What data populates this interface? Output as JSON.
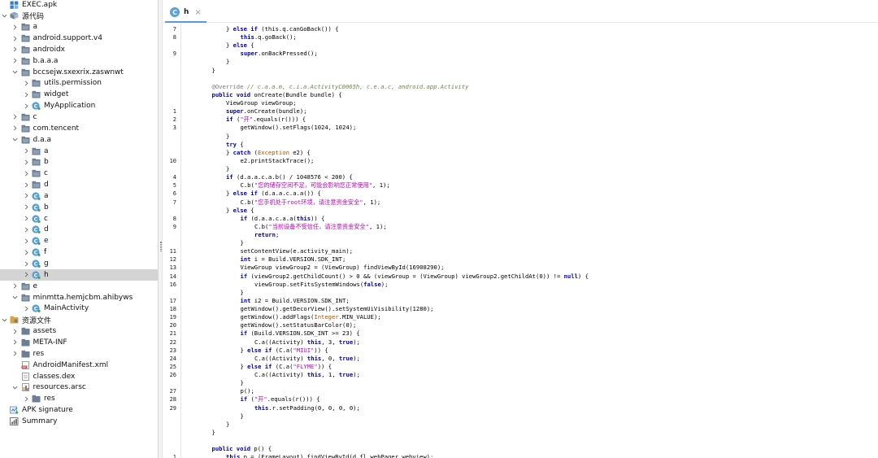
{
  "tree": [
    {
      "label": "EXEC.apk",
      "icon": "apk-icon",
      "chev": "none",
      "indent": 0
    },
    {
      "label": "源代码",
      "icon": "source-icon",
      "chev": "down",
      "indent": 0
    },
    {
      "label": "a",
      "icon": "package-icon",
      "chev": "right",
      "indent": 1
    },
    {
      "label": "android.support.v4",
      "icon": "package-icon",
      "chev": "right",
      "indent": 1
    },
    {
      "label": "androidx",
      "icon": "package-icon",
      "chev": "right",
      "indent": 1
    },
    {
      "label": "b.a.a.a",
      "icon": "package-icon",
      "chev": "right",
      "indent": 1
    },
    {
      "label": "bccsejw.sxexrix.zaswnwt",
      "icon": "package-icon",
      "chev": "down",
      "indent": 1
    },
    {
      "label": "utils.permission",
      "icon": "package-icon",
      "chev": "right",
      "indent": 2
    },
    {
      "label": "widget",
      "icon": "package-icon",
      "chev": "right",
      "indent": 2
    },
    {
      "label": "MyApplication",
      "icon": "class-icon",
      "chev": "right",
      "indent": 2
    },
    {
      "label": "c",
      "icon": "package-icon",
      "chev": "right",
      "indent": 1
    },
    {
      "label": "com.tencent",
      "icon": "package-icon",
      "chev": "right",
      "indent": 1
    },
    {
      "label": "d.a.a",
      "icon": "package-icon",
      "chev": "down",
      "indent": 1
    },
    {
      "label": "a",
      "icon": "package-icon",
      "chev": "right",
      "indent": 2
    },
    {
      "label": "b",
      "icon": "package-icon",
      "chev": "right",
      "indent": 2
    },
    {
      "label": "c",
      "icon": "package-icon",
      "chev": "right",
      "indent": 2
    },
    {
      "label": "d",
      "icon": "package-icon",
      "chev": "right",
      "indent": 2
    },
    {
      "label": "a",
      "icon": "class-icon",
      "chev": "right",
      "indent": 2
    },
    {
      "label": "b",
      "icon": "class-icon",
      "chev": "right",
      "indent": 2
    },
    {
      "label": "c",
      "icon": "class-icon",
      "chev": "right",
      "indent": 2
    },
    {
      "label": "d",
      "icon": "class-icon",
      "chev": "right",
      "indent": 2
    },
    {
      "label": "e",
      "icon": "class-icon",
      "chev": "right",
      "indent": 2
    },
    {
      "label": "f",
      "icon": "class-icon",
      "chev": "right",
      "indent": 2
    },
    {
      "label": "g",
      "icon": "class-icon",
      "chev": "right",
      "indent": 2
    },
    {
      "label": "h",
      "icon": "class-icon",
      "chev": "right",
      "indent": 2,
      "selected": true
    },
    {
      "label": "e",
      "icon": "package-icon",
      "chev": "right",
      "indent": 1
    },
    {
      "label": "minmtta.hemjcbm.ahibyws",
      "icon": "package-icon",
      "chev": "down",
      "indent": 1
    },
    {
      "label": "MainActivity",
      "icon": "class-icon",
      "chev": "right",
      "indent": 2
    },
    {
      "label": "资源文件",
      "icon": "resources-icon",
      "chev": "down",
      "indent": 0
    },
    {
      "label": "assets",
      "icon": "folder-icon",
      "chev": "right",
      "indent": 1
    },
    {
      "label": "META-INF",
      "icon": "folder-icon",
      "chev": "right",
      "indent": 1
    },
    {
      "label": "res",
      "icon": "folder-icon",
      "chev": "right",
      "indent": 1
    },
    {
      "label": "AndroidManifest.xml",
      "icon": "xml-file-icon",
      "chev": "none",
      "indent": 1
    },
    {
      "label": "classes.dex",
      "icon": "file-icon",
      "chev": "none",
      "indent": 1
    },
    {
      "label": "resources.arsc",
      "icon": "arsc-file-icon",
      "chev": "down",
      "indent": 1
    },
    {
      "label": "res",
      "icon": "folder-icon",
      "chev": "right",
      "indent": 2
    },
    {
      "label": "APK signature",
      "icon": "signature-icon",
      "chev": "none",
      "indent": 0
    },
    {
      "label": "Summary",
      "icon": "summary-icon",
      "chev": "none",
      "indent": 0
    }
  ],
  "editor": {
    "tab": {
      "icon_letter": "C",
      "name": "h",
      "close": "×"
    },
    "lines": [
      {
        "n": "7",
        "i": 2,
        "t": [
          [
            "n",
            "} "
          ],
          [
            "k",
            "else if"
          ],
          [
            "n",
            " (this.q.canGoBack()) {"
          ]
        ]
      },
      {
        "n": "8",
        "i": 3,
        "t": [
          [
            "k",
            "this"
          ],
          [
            "n",
            ".q.goBack();"
          ]
        ]
      },
      {
        "n": "",
        "i": 2,
        "t": [
          [
            "n",
            "} "
          ],
          [
            "k",
            "else"
          ],
          [
            "n",
            " {"
          ]
        ]
      },
      {
        "n": "9",
        "i": 3,
        "t": [
          [
            "k",
            "super"
          ],
          [
            "n",
            ".onBackPressed();"
          ]
        ]
      },
      {
        "n": "",
        "i": 2,
        "t": [
          [
            "n",
            "}"
          ]
        ]
      },
      {
        "n": "",
        "i": 1,
        "t": [
          [
            "n",
            "}"
          ]
        ]
      },
      {
        "n": "",
        "i": 0,
        "t": []
      },
      {
        "n": "",
        "i": 1,
        "t": [
          [
            "a",
            "@Override"
          ],
          [
            "c",
            " // c.a.a.m, c.i.a.ActivityC0065h, c.e.a.c, android.app.Activity"
          ]
        ]
      },
      {
        "n": "",
        "i": 1,
        "t": [
          [
            "k",
            "public void"
          ],
          [
            "n",
            " onCreate(Bundle bundle) {"
          ]
        ]
      },
      {
        "n": "",
        "i": 2,
        "t": [
          [
            "n",
            "ViewGroup viewGroup;"
          ]
        ]
      },
      {
        "n": "1",
        "i": 2,
        "t": [
          [
            "k",
            "super"
          ],
          [
            "n",
            ".onCreate(bundle);"
          ]
        ]
      },
      {
        "n": "2",
        "i": 2,
        "t": [
          [
            "k",
            "if"
          ],
          [
            "n",
            " ("
          ],
          [
            "s",
            "\"开\""
          ],
          [
            "n",
            ".equals(r())) {"
          ]
        ]
      },
      {
        "n": "3",
        "i": 3,
        "t": [
          [
            "n",
            "getWindow().setFlags(1024, 1024);"
          ]
        ]
      },
      {
        "n": "",
        "i": 2,
        "t": [
          [
            "n",
            "}"
          ]
        ]
      },
      {
        "n": "",
        "i": 2,
        "t": [
          [
            "k",
            "try"
          ],
          [
            "n",
            " {"
          ]
        ]
      },
      {
        "n": "",
        "i": 2,
        "t": [
          [
            "n",
            "} "
          ],
          [
            "k",
            "catch"
          ],
          [
            "n",
            " ("
          ],
          [
            "ex",
            "Exception"
          ],
          [
            "n",
            " e2) {"
          ]
        ]
      },
      {
        "n": "10",
        "i": 3,
        "t": [
          [
            "n",
            "e2.printStackTrace();"
          ]
        ]
      },
      {
        "n": "",
        "i": 2,
        "t": [
          [
            "n",
            "}"
          ]
        ]
      },
      {
        "n": "4",
        "i": 2,
        "t": [
          [
            "k",
            "if"
          ],
          [
            "n",
            " (d.a.a.c.a.b() / 1048576 < 200) {"
          ]
        ]
      },
      {
        "n": "5",
        "i": 3,
        "t": [
          [
            "n",
            "C.b("
          ],
          [
            "s",
            "\"您的储存空间不足，可能会影响您正常使用\""
          ],
          [
            "n",
            ", 1);"
          ]
        ]
      },
      {
        "n": "6",
        "i": 2,
        "t": [
          [
            "n",
            "} "
          ],
          [
            "k",
            "else if"
          ],
          [
            "n",
            " (d.a.a.c.a.a()) {"
          ]
        ]
      },
      {
        "n": "7",
        "i": 3,
        "t": [
          [
            "n",
            "C.b("
          ],
          [
            "s",
            "\"您手机处于root环境，请注意资金安全\""
          ],
          [
            "n",
            ", 1);"
          ]
        ]
      },
      {
        "n": "",
        "i": 2,
        "t": [
          [
            "n",
            "} "
          ],
          [
            "k",
            "else"
          ],
          [
            "n",
            " {"
          ]
        ]
      },
      {
        "n": "8",
        "i": 3,
        "t": [
          [
            "k",
            "if"
          ],
          [
            "n",
            " (d.a.a.c.a.a("
          ],
          [
            "k",
            "this"
          ],
          [
            "n",
            ")) {"
          ]
        ]
      },
      {
        "n": "9",
        "i": 4,
        "t": [
          [
            "n",
            "C.b("
          ],
          [
            "s",
            "\"当前设备不受信任，请注意资金安全\""
          ],
          [
            "n",
            ", 1);"
          ]
        ]
      },
      {
        "n": "",
        "i": 4,
        "t": [
          [
            "k",
            "return"
          ],
          [
            "n",
            ";"
          ]
        ]
      },
      {
        "n": "",
        "i": 3,
        "t": [
          [
            "n",
            "}"
          ]
        ]
      },
      {
        "n": "11",
        "i": 3,
        "t": [
          [
            "n",
            "setContentView(e.activity_main);"
          ]
        ]
      },
      {
        "n": "12",
        "i": 3,
        "t": [
          [
            "k",
            "int"
          ],
          [
            "n",
            " i = Build.VERSION.SDK_INT;"
          ]
        ]
      },
      {
        "n": "13",
        "i": 3,
        "t": [
          [
            "n",
            "ViewGroup viewGroup2 = (ViewGroup) findViewById(16908290);"
          ]
        ]
      },
      {
        "n": "14",
        "i": 3,
        "t": [
          [
            "k",
            "if"
          ],
          [
            "n",
            " (viewGroup2.getChildCount() > 0 && (viewGroup = (ViewGroup) viewGroup2.getChildAt(0)) != "
          ],
          [
            "k",
            "null"
          ],
          [
            "n",
            ") {"
          ]
        ]
      },
      {
        "n": "16",
        "i": 4,
        "t": [
          [
            "n",
            "viewGroup.setFitsSystemWindows("
          ],
          [
            "k",
            "false"
          ],
          [
            "n",
            ");"
          ]
        ]
      },
      {
        "n": "",
        "i": 3,
        "t": [
          [
            "n",
            "}"
          ]
        ]
      },
      {
        "n": "17",
        "i": 3,
        "t": [
          [
            "k",
            "int"
          ],
          [
            "n",
            " i2 = Build.VERSION.SDK_INT;"
          ]
        ]
      },
      {
        "n": "18",
        "i": 3,
        "t": [
          [
            "n",
            "getWindow().getDecorView().setSystemUiVisibility(1280);"
          ]
        ]
      },
      {
        "n": "19",
        "i": 3,
        "t": [
          [
            "n",
            "getWindow().addFlags("
          ],
          [
            "ex",
            "Integer"
          ],
          [
            "n",
            ".MIN_VALUE);"
          ]
        ]
      },
      {
        "n": "20",
        "i": 3,
        "t": [
          [
            "n",
            "getWindow().setStatusBarColor(0);"
          ]
        ]
      },
      {
        "n": "21",
        "i": 3,
        "t": [
          [
            "k",
            "if"
          ],
          [
            "n",
            " (Build.VERSION.SDK_INT >= 23) {"
          ]
        ]
      },
      {
        "n": "22",
        "i": 4,
        "t": [
          [
            "n",
            "C.a((Activity) "
          ],
          [
            "k",
            "this"
          ],
          [
            "n",
            ", 3, "
          ],
          [
            "k",
            "true"
          ],
          [
            "n",
            ");"
          ]
        ]
      },
      {
        "n": "23",
        "i": 3,
        "t": [
          [
            "n",
            "} "
          ],
          [
            "k",
            "else if"
          ],
          [
            "n",
            " (C.a("
          ],
          [
            "s",
            "\"MIUI\""
          ],
          [
            "n",
            ")) {"
          ]
        ]
      },
      {
        "n": "24",
        "i": 4,
        "t": [
          [
            "n",
            "C.a((Activity) "
          ],
          [
            "k",
            "this"
          ],
          [
            "n",
            ", 0, "
          ],
          [
            "k",
            "true"
          ],
          [
            "n",
            ");"
          ]
        ]
      },
      {
        "n": "25",
        "i": 3,
        "t": [
          [
            "n",
            "} "
          ],
          [
            "k",
            "else if"
          ],
          [
            "n",
            " (C.a("
          ],
          [
            "s",
            "\"FLYME\""
          ],
          [
            "n",
            ")) {"
          ]
        ]
      },
      {
        "n": "26",
        "i": 4,
        "t": [
          [
            "n",
            "C.a((Activity) "
          ],
          [
            "k",
            "this"
          ],
          [
            "n",
            ", 1, "
          ],
          [
            "k",
            "true"
          ],
          [
            "n",
            ");"
          ]
        ]
      },
      {
        "n": "",
        "i": 3,
        "t": [
          [
            "n",
            "}"
          ]
        ]
      },
      {
        "n": "27",
        "i": 3,
        "t": [
          [
            "n",
            "p();"
          ]
        ]
      },
      {
        "n": "28",
        "i": 3,
        "t": [
          [
            "k",
            "if"
          ],
          [
            "n",
            " ("
          ],
          [
            "s",
            "\"开\""
          ],
          [
            "n",
            ".equals(r())) {"
          ]
        ]
      },
      {
        "n": "29",
        "i": 4,
        "t": [
          [
            "k",
            "this"
          ],
          [
            "n",
            ".r.setPadding(0, 0, 0, 0);"
          ]
        ]
      },
      {
        "n": "",
        "i": 3,
        "t": [
          [
            "n",
            "}"
          ]
        ]
      },
      {
        "n": "",
        "i": 2,
        "t": [
          [
            "n",
            "}"
          ]
        ]
      },
      {
        "n": "",
        "i": 1,
        "t": [
          [
            "n",
            "}"
          ]
        ]
      },
      {
        "n": "",
        "i": 0,
        "t": []
      },
      {
        "n": "",
        "i": 1,
        "t": [
          [
            "k",
            "public void"
          ],
          [
            "n",
            " p() {"
          ]
        ]
      },
      {
        "n": "1",
        "i": 2,
        "t": [
          [
            "k",
            "this"
          ],
          [
            "n",
            ".p = (FrameLayout) findViewById(d.fl_webPager_webview);"
          ]
        ]
      }
    ]
  }
}
